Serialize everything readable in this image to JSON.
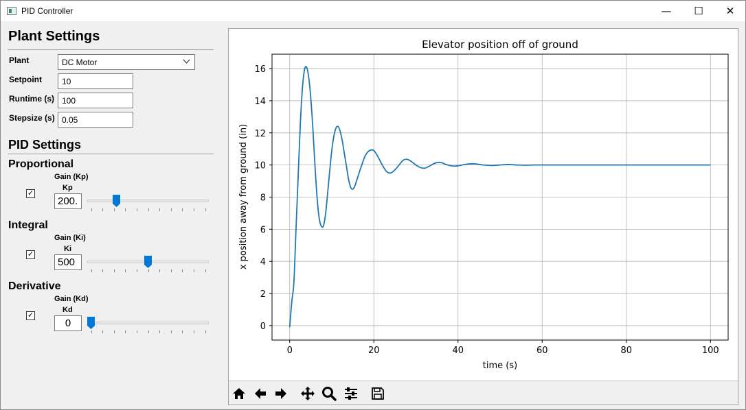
{
  "window": {
    "title": "PID Controller",
    "controls": {
      "minimize": "—",
      "maximize": "☐",
      "close": "✕"
    }
  },
  "plant_settings": {
    "title": "Plant Settings",
    "plant_label": "Plant",
    "plant_value": "DC Motor",
    "setpoint_label": "Setpoint",
    "setpoint_value": "10",
    "runtime_label": "Runtime (s)",
    "runtime_value": "100",
    "stepsize_label": "Stepsize (s)",
    "stepsize_value": "0.05"
  },
  "pid_settings": {
    "title": "PID Settings",
    "proportional": {
      "title": "Proportional",
      "gain_label": "Gain (Kp)",
      "short_label": "Kp",
      "value": "200.",
      "checked": true,
      "slider_fraction": 0.22
    },
    "integral": {
      "title": "Integral",
      "gain_label": "Gain (Ki)",
      "short_label": "Ki",
      "value": "500",
      "checked": true,
      "slider_fraction": 0.5
    },
    "derivative": {
      "title": "Derivative",
      "gain_label": "Gain (Kd)",
      "short_label": "Kd",
      "value": "0",
      "checked": true,
      "slider_fraction": 0.0
    }
  },
  "toolbar": {
    "buttons": [
      "home-icon",
      "back-arrow-icon",
      "forward-arrow-icon",
      "pan-icon",
      "zoom-icon",
      "configure-subplots-icon",
      "save-icon"
    ]
  },
  "chart_data": {
    "type": "line",
    "title": "Elevator position off of ground",
    "xlabel": "time (s)",
    "ylabel": "x position away from ground (in)",
    "xlim": [
      -4.2,
      104.2
    ],
    "ylim": [
      -0.9,
      16.9
    ],
    "xticks": [
      0,
      20,
      40,
      60,
      80,
      100
    ],
    "yticks": [
      0,
      2,
      4,
      6,
      8,
      10,
      12,
      14,
      16
    ],
    "grid": true,
    "line_color": "#1f77b4",
    "series": [
      {
        "x": [
          0,
          0.5,
          1,
          1.5,
          2,
          2.5,
          3,
          3.5,
          4,
          4.5,
          5,
          5.5,
          6,
          6.5,
          7,
          7.5,
          8,
          8.5,
          9,
          9.5,
          10,
          10.5,
          11,
          11.5,
          12,
          12.5,
          13,
          13.5,
          14,
          14.5,
          15,
          15.5,
          16,
          17,
          18,
          19,
          20,
          21,
          22,
          23,
          24,
          25,
          26,
          27,
          28,
          29,
          30,
          31,
          32,
          33,
          34,
          35,
          36,
          37,
          38,
          39,
          40,
          42,
          44,
          46,
          48,
          50,
          52,
          54,
          56,
          58,
          60,
          65,
          70,
          80,
          90,
          100
        ],
        "y": [
          -0.1,
          1.5,
          2.7,
          6.0,
          9.2,
          12.4,
          14.7,
          15.9,
          16.1,
          15.5,
          14.2,
          12.3,
          10.0,
          8.0,
          6.7,
          6.2,
          6.2,
          6.9,
          8.2,
          9.6,
          10.9,
          11.8,
          12.3,
          12.4,
          12.1,
          11.5,
          10.7,
          9.9,
          9.1,
          8.6,
          8.5,
          8.7,
          9.1,
          9.9,
          10.6,
          10.9,
          10.9,
          10.5,
          10.0,
          9.6,
          9.5,
          9.7,
          10.0,
          10.3,
          10.35,
          10.2,
          10.0,
          9.85,
          9.8,
          9.9,
          10.05,
          10.15,
          10.15,
          10.05,
          9.97,
          9.93,
          9.95,
          10.05,
          10.07,
          10.0,
          9.97,
          10.0,
          10.03,
          10.0,
          9.99,
          10.0,
          10.0,
          10.0,
          10.0,
          10.0,
          10.0,
          10.0
        ]
      }
    ]
  }
}
